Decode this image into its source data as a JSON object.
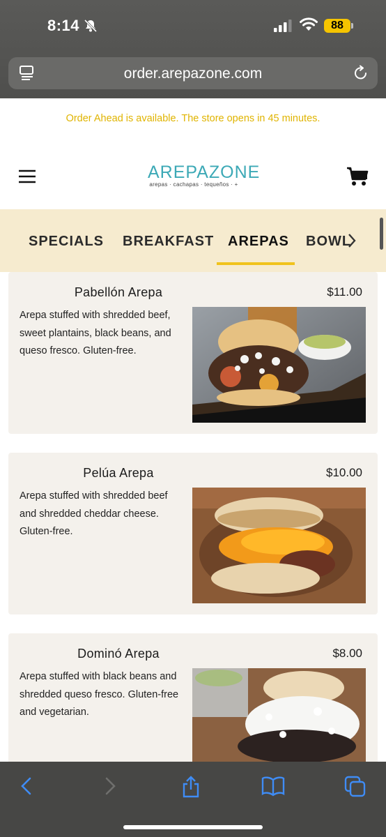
{
  "status_bar": {
    "time": "8:14",
    "battery": "88"
  },
  "browser": {
    "url": "order.arepazone.com"
  },
  "notice": "Order Ahead is available. The store opens in 45 minutes.",
  "logo": {
    "name": "AREPAZONE",
    "tagline": "arepas · cachapas · tequeños · +"
  },
  "categories": [
    {
      "label": "SPECIALS"
    },
    {
      "label": "BREAKFAST"
    },
    {
      "label": "AREPAS",
      "active": true
    },
    {
      "label": "BOWL"
    }
  ],
  "items": [
    {
      "title": "Pabellón Arepa",
      "price": "$11.00",
      "description": "Arepa stuffed with shredded beef, sweet plantains, black beans, and queso fresco. Gluten-free."
    },
    {
      "title": "Pelúa Arepa",
      "price": "$10.00",
      "description": "Arepa stuffed with shredded beef and shredded cheddar cheese. Gluten-free."
    },
    {
      "title": "Dominó Arepa",
      "price": "$8.00",
      "description": "Arepa stuffed with black beans and shredded queso fresco. Gluten-free and vegetarian."
    }
  ],
  "colors": {
    "accent": "#f0c31d",
    "notice": "#e0b400",
    "nav_bg": "#f6ebcf",
    "card_bg": "#f4f1ec",
    "toolbar_icon": "#3f8cf5"
  },
  "icons": [
    "bell-off-icon",
    "signal-icon",
    "wifi-icon",
    "battery-icon",
    "reader-icon",
    "reload-icon",
    "hamburger-menu-icon",
    "cart-icon",
    "chevron-right-icon",
    "back-icon",
    "forward-icon",
    "share-icon",
    "bookmarks-icon",
    "tabs-icon"
  ]
}
